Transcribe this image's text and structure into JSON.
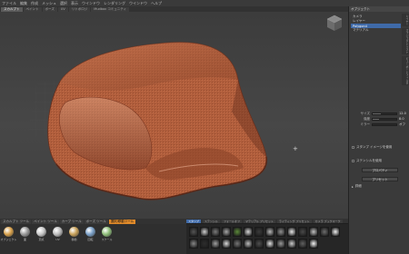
{
  "menubar": [
    "ファイル",
    "編集",
    "作成",
    "メッシュ",
    "選択",
    "表示",
    "ウインドウ",
    "レンダリング",
    "ウインドウ",
    "ヘルプ"
  ],
  "tabs": [
    {
      "label": "スカルプト",
      "active": true
    },
    {
      "label": "ペイント",
      "active": false
    },
    {
      "label": "ポーズ",
      "active": false
    },
    {
      "label": "UV",
      "active": false
    },
    {
      "label": "リトポロジ",
      "active": false
    },
    {
      "label": "Mudbox コミュニティ",
      "active": false
    }
  ],
  "right_panel": {
    "header": "オブジェクト",
    "rows": [
      {
        "label": "カメラ",
        "selected": false
      },
      {
        "label": "レイヤー",
        "selected": false
      },
      {
        "label": "Polygon4",
        "selected": true
      },
      {
        "label": "マテリアル",
        "selected": false
      }
    ],
    "vtabs": [
      "レイヤー",
      "オブジェクトリスト",
      "ビューポートフィルタ"
    ],
    "props": [
      {
        "label": "サイズ",
        "value": "12.0",
        "fill": 0.35
      },
      {
        "label": "強度",
        "value": "8.0",
        "fill": 0.25
      },
      {
        "label": "ミラー",
        "value": "オフ",
        "fill": 0
      }
    ],
    "buttons": [
      "プロパティ",
      "プリセット"
    ],
    "checks": [
      "スタンプ イメージを使用",
      "ステンシルを使用"
    ],
    "footer_label": "詳細"
  },
  "bottom_tabs": [
    {
      "label": "スカルプト ツール",
      "state": "normal"
    },
    {
      "label": "ペイント ツール",
      "state": "normal"
    },
    {
      "label": "カーブ ツール",
      "state": "normal"
    },
    {
      "label": "ポーズ ツール",
      "state": "normal"
    },
    {
      "label": "選択/移動ツール",
      "state": "active"
    }
  ],
  "bottom_right_tabs": [
    {
      "label": "スタンプ",
      "state": "blue"
    },
    {
      "label": "ステンシル",
      "state": "normal"
    },
    {
      "label": "フォールオフ",
      "state": "normal"
    },
    {
      "label": "マテリアル プリセット",
      "state": "normal"
    },
    {
      "label": "ライティング プリセット",
      "state": "normal"
    },
    {
      "label": "カメラ ブックマーク",
      "state": "normal"
    }
  ],
  "tools": [
    {
      "label": "オブジェクト",
      "color": "#d9a14a",
      "icon": "object-select-icon"
    },
    {
      "label": "面",
      "color": "#9a9a9a",
      "icon": "face-select-icon"
    },
    {
      "label": "頂点",
      "color": "#c8c8c8",
      "icon": "vertex-select-icon"
    },
    {
      "label": "UV",
      "color": "#bcbcbc",
      "icon": "uv-select-icon"
    },
    {
      "label": "移動",
      "color": "#c9a25a",
      "icon": "translate-icon"
    },
    {
      "label": "回転",
      "color": "#7aa0c8",
      "icon": "rotate-icon"
    },
    {
      "label": "スケール",
      "color": "#8fbf7a",
      "icon": "scale-icon"
    }
  ],
  "stamps": [
    "#555",
    "#cfcfcf",
    "#7b7b7b",
    "#a8a8a8",
    "#5d8c3a",
    "#d8d8d8",
    "#3b3b3b",
    "#b8b8b8",
    "#919191",
    "#e8e8e8",
    "#4a4a4a",
    "#c2c2c2",
    "#6d6d6d",
    "#f0f0f0",
    "#888888",
    "#2e2e2e",
    "#a0a0a0",
    "#dcdcdc",
    "#777777",
    "#bdbdbd",
    "#4e4e4e",
    "#e2e2e2",
    "#999999",
    "#cccccc",
    "#626262",
    "#f6f6f6"
  ],
  "model_color": "#b4623f"
}
